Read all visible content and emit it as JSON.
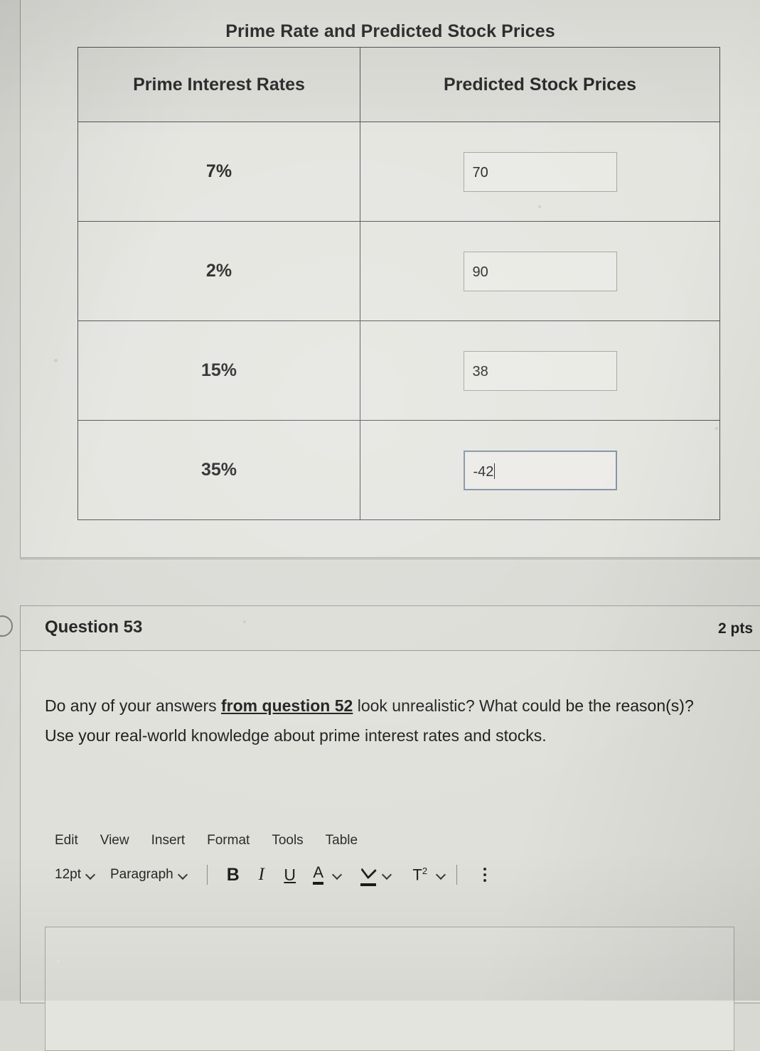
{
  "top_cutoff_text": "Rate and Predicted Sto",
  "table_block": {
    "title": "Prime Rate and Predicted Stock Prices",
    "headers": [
      "Prime Interest Rates",
      "Predicted Stock Prices"
    ],
    "rows": [
      {
        "rate": "7%",
        "price": "70",
        "focused": false
      },
      {
        "rate": "2%",
        "price": "90",
        "focused": false
      },
      {
        "rate": "15%",
        "price": "38",
        "focused": false
      },
      {
        "rate": "35%",
        "price": "-42",
        "focused": true
      }
    ]
  },
  "question": {
    "title": "Question 53",
    "points": "2 pts",
    "prompt_part1": "Do any of your answers ",
    "prompt_link": "from question 52",
    "prompt_part2": " look unrealistic? What could be the reason(s)?  Use your real-world knowledge about prime interest rates and stocks."
  },
  "editor": {
    "menu": [
      "Edit",
      "View",
      "Insert",
      "Format",
      "Tools",
      "Table"
    ],
    "font_size": "12pt",
    "block_format": "Paragraph",
    "bold_label": "B",
    "italic_label": "I",
    "underline_label": "U",
    "text_color_label": "A",
    "superscript_label": "T",
    "superscript_exponent": "2",
    "answer_value": "",
    "answer_placeholder": ""
  },
  "colors": {
    "page_background": "#d9d9d4",
    "card_background": "#e0e0da",
    "table_border": "#4e4e52",
    "input_border": "#a3a49f",
    "focused_input_border": "#7d8ea3",
    "text": "#1c1c1c"
  }
}
